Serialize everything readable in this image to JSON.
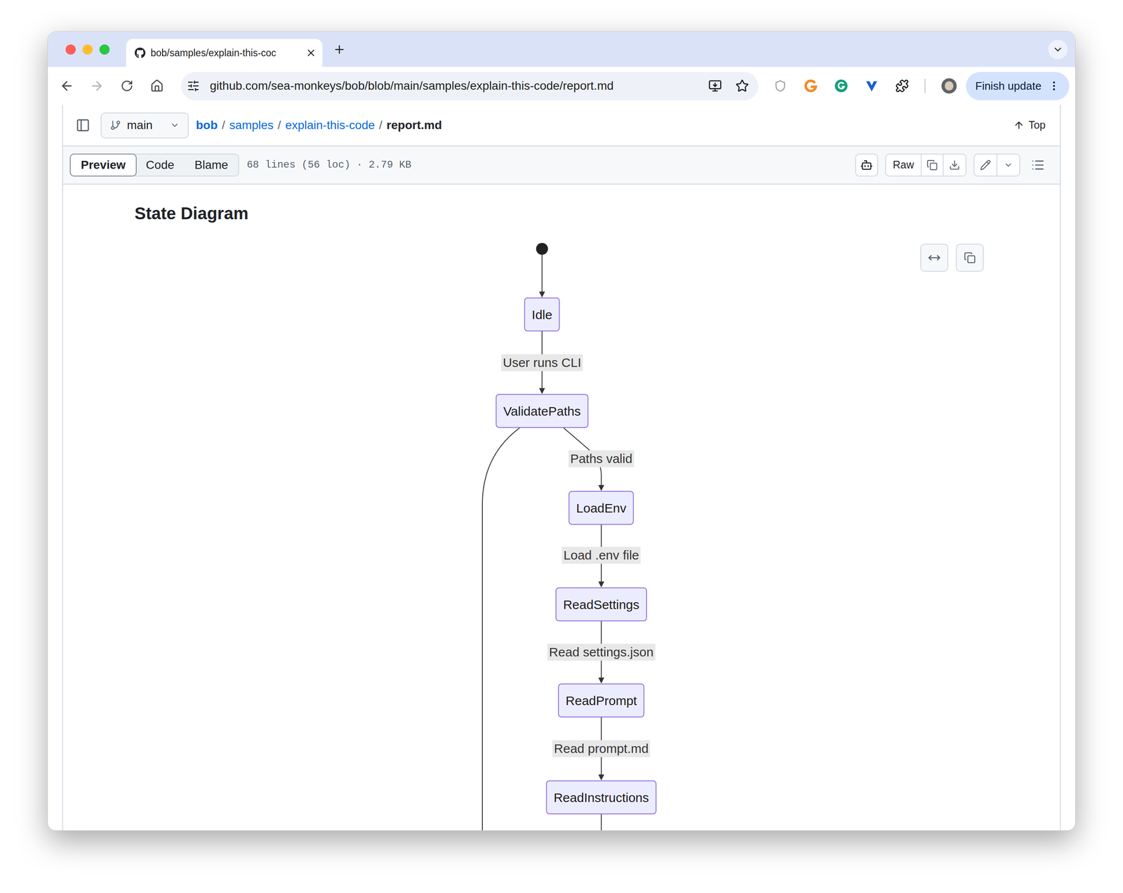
{
  "browser": {
    "tab_title": "bob/samples/explain-this-coc",
    "url": "github.com/sea-monkeys/bob/blob/main/samples/explain-this-code/report.md",
    "update_button": "Finish update"
  },
  "repo_bar": {
    "branch": "main",
    "breadcrumb": [
      {
        "label": "bob",
        "link": true
      },
      {
        "label": "samples",
        "link": true
      },
      {
        "label": "explain-this-code",
        "link": true
      },
      {
        "label": "report.md",
        "link": false
      }
    ],
    "separator": "/",
    "top_link": "Top"
  },
  "file_header": {
    "views": [
      {
        "label": "Preview",
        "selected": true
      },
      {
        "label": "Code",
        "selected": false
      },
      {
        "label": "Blame",
        "selected": false
      }
    ],
    "info": "68 lines (56 loc) · 2.79 KB",
    "raw_button": "Raw"
  },
  "document": {
    "heading": "State Diagram",
    "diagram": {
      "nodes": [
        {
          "name": "Idle",
          "initial": true
        },
        {
          "name": "ValidatePaths",
          "initial": false
        },
        {
          "name": "LoadEnv",
          "initial": false
        },
        {
          "name": "ReadSettings",
          "initial": false
        },
        {
          "name": "ReadPrompt",
          "initial": false
        },
        {
          "name": "ReadInstructions",
          "initial": false
        }
      ],
      "edges": [
        {
          "from": "Idle",
          "to": "ValidatePaths",
          "label": "User runs CLI"
        },
        {
          "from": "ValidatePaths",
          "to": "LoadEnv",
          "label": "Paths valid"
        },
        {
          "from": "LoadEnv",
          "to": "ReadSettings",
          "label": "Load .env file"
        },
        {
          "from": "ReadSettings",
          "to": "ReadPrompt",
          "label": "Read settings.json"
        },
        {
          "from": "ReadPrompt",
          "to": "ReadInstructions",
          "label": "Read prompt.md"
        },
        {
          "from": "ReadInstructions",
          "to": null,
          "label": null
        },
        {
          "from": "ValidatePaths",
          "to": null,
          "label": null
        }
      ]
    }
  }
}
